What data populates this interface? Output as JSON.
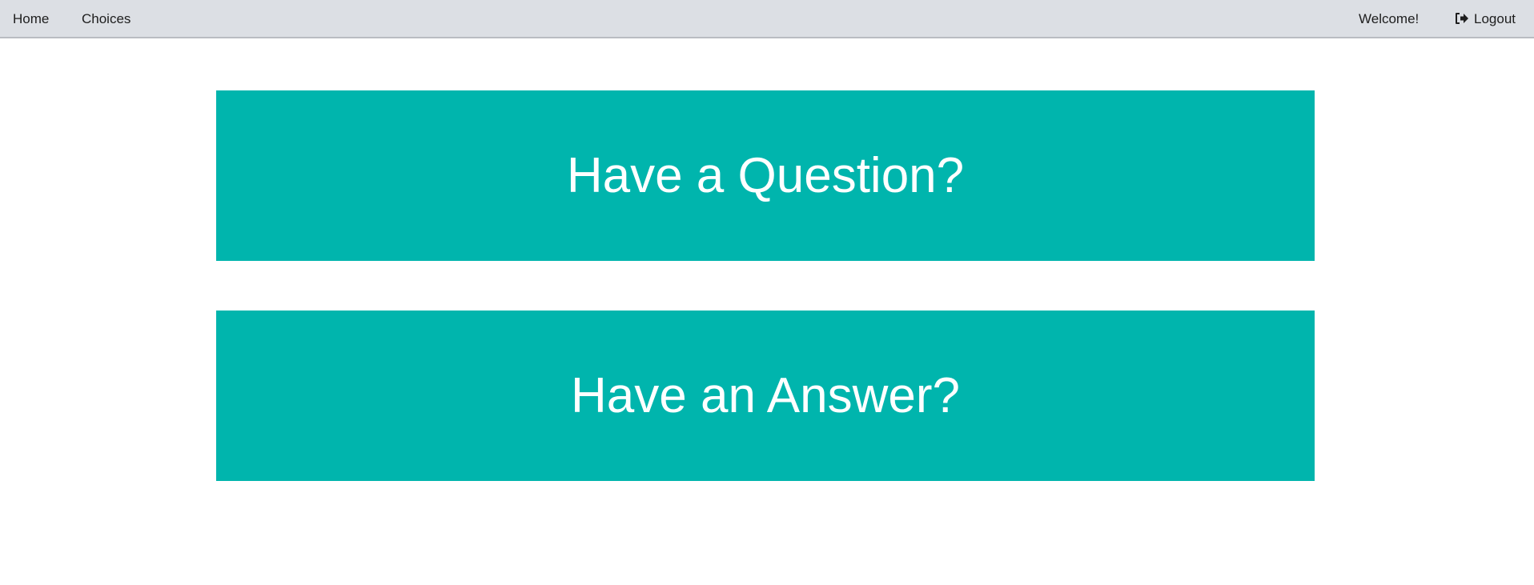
{
  "navbar": {
    "home_label": "Home",
    "choices_label": "Choices",
    "welcome_text": "Welcome!",
    "logout_label": "Logout",
    "logout_icon": "sign-out-icon"
  },
  "cards": {
    "question_label": "Have a Question?",
    "answer_label": "Have an Answer?"
  },
  "colors": {
    "navbar_background": "#dcdfe4",
    "card_accent": "#00b5ad",
    "card_text": "#ffffff"
  }
}
